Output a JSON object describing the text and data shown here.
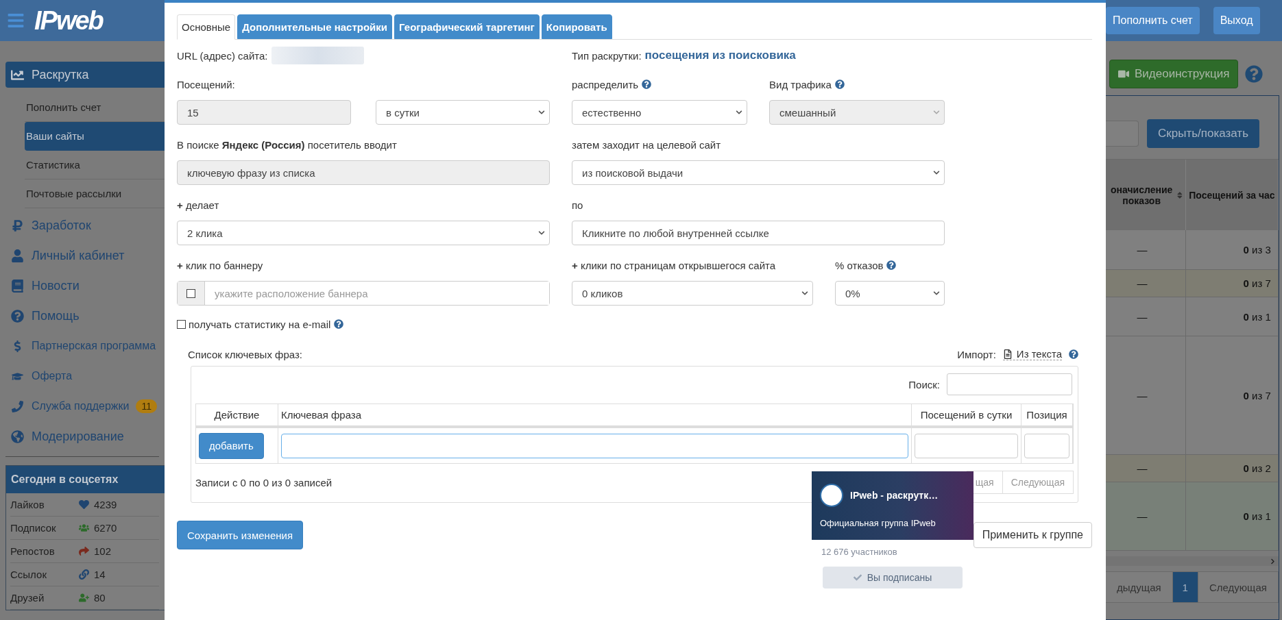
{
  "sidebar": {
    "logo": "IPweb",
    "menu": [
      {
        "label": "Раскрутка",
        "kind": "primary",
        "selected": true,
        "children": [
          {
            "label": "Пополнить счет",
            "selected": false
          },
          {
            "label": "Ваши сайты",
            "selected": true
          },
          {
            "label": "Статистика",
            "selected": false
          },
          {
            "label": "Почтовые рассылки",
            "selected": false
          }
        ]
      },
      {
        "label": "Заработок",
        "kind": "primary",
        "selected": false
      },
      {
        "label": "Личный кабинет",
        "kind": "primary",
        "selected": false
      },
      {
        "label": "Новости",
        "kind": "primary",
        "selected": false
      },
      {
        "label": "Помощь",
        "kind": "primary",
        "selected": false
      },
      {
        "label": "Партнерская программа",
        "kind": "secondary",
        "selected": false
      },
      {
        "label": "Оферта",
        "kind": "secondary",
        "selected": false
      },
      {
        "label": "Служба поддержки",
        "kind": "secondary",
        "selected": false,
        "badge": "11"
      },
      {
        "label": "Модерирование",
        "kind": "primary",
        "selected": false
      }
    ],
    "social": {
      "title": "Сегодня в соцсетях",
      "rows": [
        {
          "label": "Лайков",
          "value": "4239"
        },
        {
          "label": "Подписок",
          "value": "6270"
        },
        {
          "label": "Репостов",
          "value": "102"
        },
        {
          "label": "Ссылок",
          "value": "14"
        },
        {
          "label": "Друзей",
          "value": "80"
        }
      ]
    }
  },
  "modal": {
    "tabs": [
      {
        "label": "Основные",
        "selected": true
      },
      {
        "label": "Дополнительные настройки",
        "selected": false
      },
      {
        "label": "Географический таргетинг",
        "selected": false
      },
      {
        "label": "Копировать",
        "selected": false
      }
    ],
    "url": {
      "label": "URL (адрес) сайта:"
    },
    "promo_type": {
      "label": "Тип раскрутки:",
      "value": "посещения из поисковика"
    },
    "visits": {
      "label": "Посещений:",
      "value": "15",
      "disabled": true,
      "period": "в сутки"
    },
    "distribute": {
      "label": "распределить",
      "value": "естественно",
      "disabled": false
    },
    "traffic": {
      "label": "Вид трафика",
      "value": "смешанный",
      "disabled": true
    },
    "search_query": {
      "label": "В поиске **Яндекс (Россия)** посетитель вводит",
      "value": "ключевую фразу из списка",
      "disabled": true
    },
    "then": {
      "label": "затем заходит на целевой сайт",
      "value": "из поисковой выдачи",
      "disabled": false
    },
    "clicks": {
      "label": "**+** делает",
      "value": "2 клика",
      "disabled": false
    },
    "by": {
      "label": "по",
      "value": "Кликните по любой внутренней ссылке",
      "disabled": false
    },
    "banner": {
      "label": "**+** клик по баннеру",
      "checked": false,
      "placeholder": "укажите расположение баннера"
    },
    "page_clicks": {
      "label": "**+** клики по страницам открывшегося сайта",
      "value": "0 кликов",
      "disabled": false
    },
    "bounce": {
      "label": "% отказов",
      "value": "0%",
      "disabled": false
    },
    "email_stats": {
      "label": "получать статистику на e-mail",
      "checked": false
    },
    "keywords": {
      "title": "Список ключевых фраз:",
      "import_label": "Импорт:",
      "import_link": "Из текста",
      "search_label": "Поиск:",
      "columns": [
        "Действие",
        "Ключевая фраза",
        "Посещений в сутки",
        "Позиция"
      ],
      "add_button": "добавить",
      "info": "Записи с 0 по 0 из 0 записей",
      "pagination": [
        "щая",
        "Следующая"
      ]
    },
    "save_button": "Сохранить изменения",
    "apply_button": "Применить к группе"
  },
  "vk_widget": {
    "name": "IPweb - раскрутк…",
    "subtitle": "Официальная группа IPweb",
    "members": "12 676 участников",
    "subscribe_button": "Вы подписаны"
  },
  "background_page": {
    "header_buttons": [
      "Пополнить счет",
      "Выход"
    ],
    "video_button": "Видеоинструкция",
    "hide_button": "Скрыть/показать",
    "table": {
      "columns": [
        "оначисление показов",
        "Посещений за час"
      ],
      "rows": [
        {
          "cells": [
            "—",
            "**0** из 3"
          ],
          "color": "#808080"
        },
        {
          "cells": [
            "—",
            "**0** из 7"
          ],
          "color": "#7e7d72"
        },
        {
          "cells": [
            "—",
            "**0** из 1"
          ],
          "color": "#808080"
        },
        {
          "cells": [
            "—",
            "**0** из 7"
          ],
          "color": "#808080"
        },
        {
          "cells": [
            "—",
            "**0** из 2"
          ],
          "color": "#7e7d72"
        },
        {
          "cells": [
            "—",
            "**0** из 1"
          ],
          "color": "#788078"
        }
      ]
    },
    "pagination": [
      {
        "label": "дыдущая",
        "selected": false
      },
      {
        "label": "1",
        "selected": true
      },
      {
        "label": "Следующая",
        "selected": false
      }
    ]
  }
}
